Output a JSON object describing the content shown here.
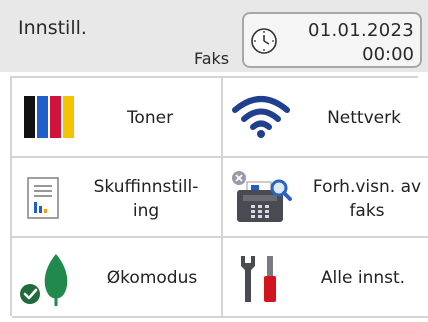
{
  "header": {
    "title": "Innstill.",
    "mode": "Faks",
    "date": "01.01.2023",
    "time": "00:00"
  },
  "tiles": [
    {
      "label": "Toner",
      "icon": "toner-cartridges-icon"
    },
    {
      "label": "Nettverk",
      "icon": "wifi-icon"
    },
    {
      "label_line1": "Skuffinnstill-",
      "label_line2": "ing",
      "icon": "tray-document-icon"
    },
    {
      "label_line1": "Forh.visn. av",
      "label_line2": "faks",
      "icon": "fax-preview-icon"
    },
    {
      "label": "Økomodus",
      "icon": "eco-leaf-icon"
    },
    {
      "label": "Alle innst.",
      "icon": "tools-icon"
    }
  ],
  "colors": {
    "toner_black": "#111111",
    "toner_cyan": "#1e5fc8",
    "toner_magenta": "#d2143c",
    "toner_yellow": "#f5c400",
    "wifi": "#1f3f8f",
    "leaf": "#1f8a4c",
    "check": "#1f6b3c"
  }
}
